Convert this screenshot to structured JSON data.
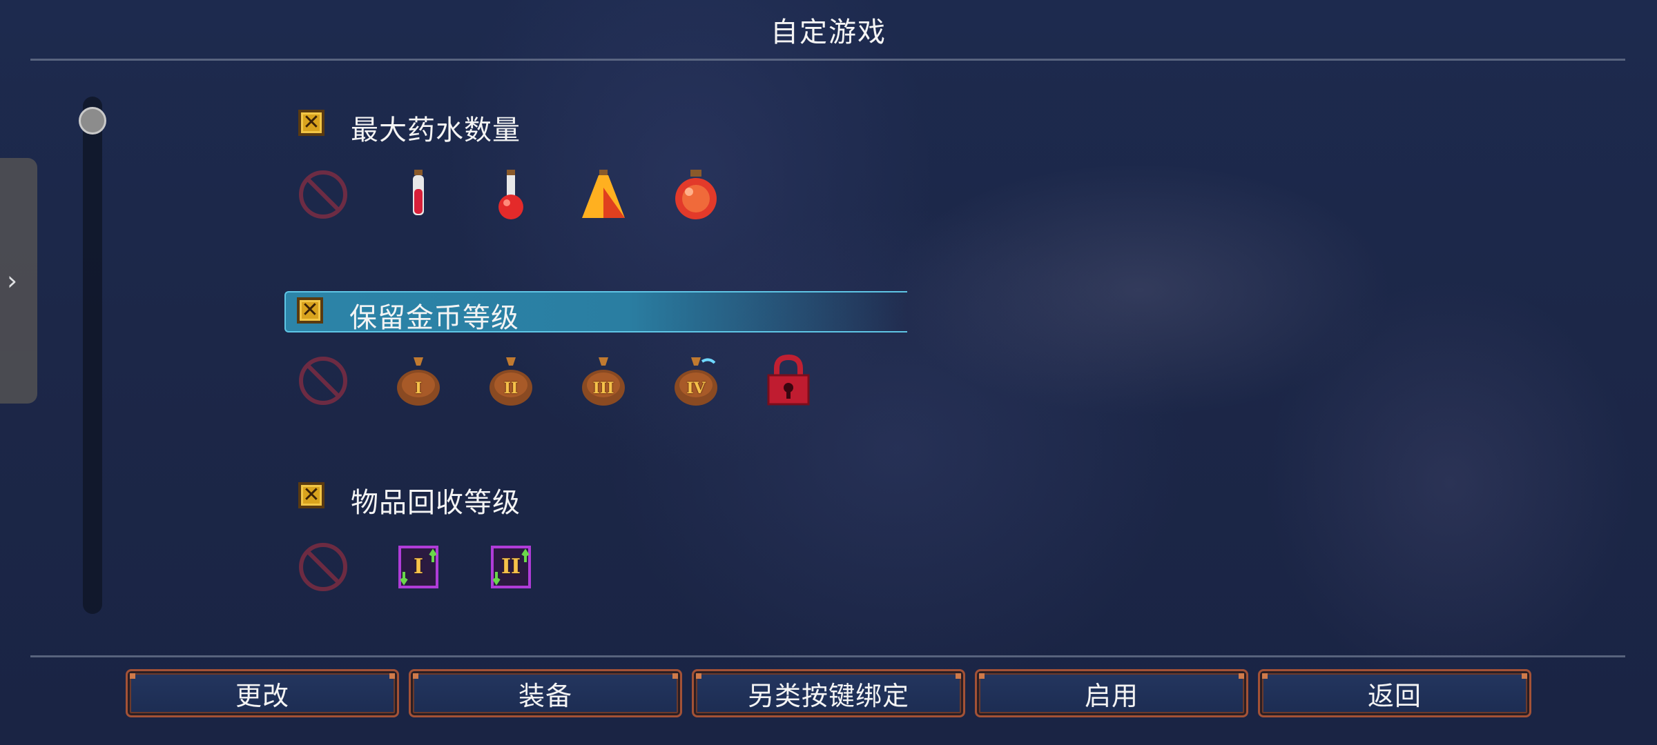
{
  "header": {
    "title": "自定游戏"
  },
  "side_tab": {
    "icon": "chevron-right-icon",
    "glyph": "›"
  },
  "sections": [
    {
      "label": "最大药水数量",
      "checked": true,
      "selected": false,
      "options": [
        "none",
        "potion-1",
        "potion-2",
        "potion-3",
        "potion-4"
      ]
    },
    {
      "label": "保留金币等级",
      "checked": true,
      "selected": true,
      "options": [
        "none",
        "gold-bag-I",
        "gold-bag-II",
        "gold-bag-III",
        "gold-bag-IV",
        "locked"
      ],
      "romans": [
        "I",
        "II",
        "III",
        "IV"
      ]
    },
    {
      "label": "物品回收等级",
      "checked": true,
      "selected": false,
      "options": [
        "none",
        "recycle-I",
        "recycle-II"
      ],
      "romans": [
        "I",
        "II"
      ]
    }
  ],
  "buttons": {
    "change": "更改",
    "equip": "装备",
    "alt_keybind": "另类按键绑定",
    "enable": "启用",
    "back": "返回"
  },
  "colors": {
    "accent_selected": "#2c84a8",
    "checkbox": "#d9a31e",
    "button_border": "#a45236",
    "background": "#1c2748"
  }
}
